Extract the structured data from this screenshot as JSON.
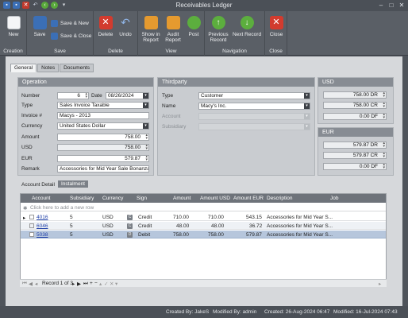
{
  "window": {
    "title": "Receivables Ledger",
    "accent": "#4b5057"
  },
  "ribbon": {
    "creation": {
      "label": "Creation",
      "new": "New"
    },
    "save": {
      "label": "Save",
      "save": "Save",
      "save_new": "Save & New",
      "save_close": "Save & Close"
    },
    "delete": {
      "label": "Delete",
      "delete": "Delete",
      "undo": "Undo"
    },
    "view": {
      "label": "View",
      "show_report": "Show in Report",
      "audit_report": "Audit Report",
      "post": "Post"
    },
    "navigation": {
      "label": "Navigation",
      "previous": "Previous Record",
      "next": "Next Record"
    },
    "close": {
      "label": "Close",
      "close": "Close"
    }
  },
  "tabs": [
    "General",
    "Notes",
    "Documents"
  ],
  "operation": {
    "header": "Operation",
    "number_label": "Number",
    "number": "6",
    "date_label": "Date",
    "date": "08/26/2024",
    "type_label": "Type",
    "type": "Sales Invoice Taxable",
    "invoice_label": "Invoice #",
    "invoice": "Macys - 2013",
    "currency_label": "Currency",
    "currency": "United States Dollar",
    "amount_label": "Amount",
    "amount": "758.00",
    "usd_label": "USD",
    "usd": "758.00",
    "eur_label": "EUR",
    "eur": "579.87",
    "remark_label": "Remark",
    "remark": "Accessories for Mid Year Sale Bonanza"
  },
  "thirdparty": {
    "header": "Thirdparty",
    "type_label": "Type",
    "type": "Customer",
    "name_label": "Name",
    "name": "Macy's Inc.",
    "account_label": "Account",
    "account": "",
    "subsidiary_label": "Subsidiary",
    "subsidiary": ""
  },
  "usd_panel": {
    "header": "USD",
    "dr": "758.00 DR",
    "cr": "758.00 CR",
    "df": "0.00 DF"
  },
  "eur_panel": {
    "header": "EUR",
    "dr": "579.87 DR",
    "cr": "579.87 CR",
    "df": "0.00 DF"
  },
  "detail_tabs": [
    "Account Detail",
    "Instalment"
  ],
  "grid": {
    "columns": [
      "Account",
      "Subsidiary",
      "Currency",
      "Sign",
      "Amount",
      "Amount USD",
      "Amount EUR",
      "Description",
      "Job"
    ],
    "add_row": "Click here to add a new row",
    "rows": [
      {
        "account": "4016",
        "subsidiary": "5",
        "currency": "USD",
        "sign_icon": "C",
        "sign": "Credit",
        "amount": "710.00",
        "amount_usd": "710.00",
        "amount_eur": "543.15",
        "description": "Accessories for Mid Year S...",
        "job": ""
      },
      {
        "account": "6046",
        "subsidiary": "5",
        "currency": "USD",
        "sign_icon": "C",
        "sign": "Credit",
        "amount": "48.00",
        "amount_usd": "48.00",
        "amount_eur": "36.72",
        "description": "Accessories for Mid Year S...",
        "job": ""
      },
      {
        "account": "5038",
        "subsidiary": "5",
        "currency": "USD",
        "sign_icon": "D",
        "sign": "Debit",
        "amount": "758.00",
        "amount_usd": "758.00",
        "amount_eur": "579.87",
        "description": "Accessories for Mid Year S...",
        "job": ""
      }
    ],
    "record_nav": "Record 1 of 3"
  },
  "status": {
    "created_by": "Created By: JakeS",
    "modified_by": "Modified By: admin",
    "created": "Created: 26-Aug-2024 06:47",
    "modified": "Modified: 16-Jul-2024 07:43"
  }
}
